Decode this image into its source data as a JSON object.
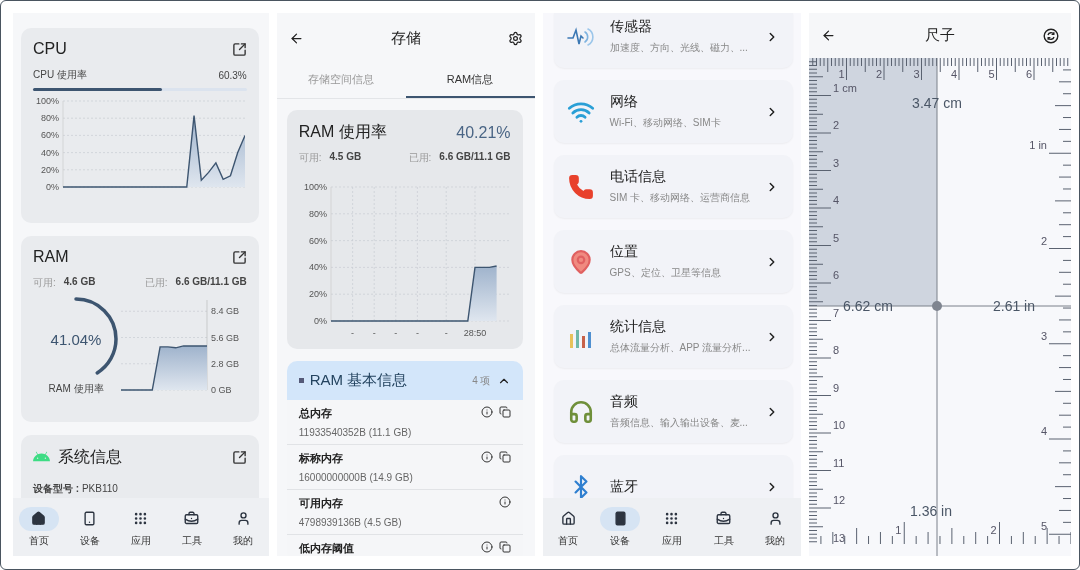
{
  "home_screen": {
    "cpu_card": {
      "title": "CPU",
      "usage_label": "CPU 使用率",
      "usage_value": "60.3%",
      "level": 0.603,
      "chart_data": {
        "type": "area",
        "grid": true,
        "ylim": [
          0,
          100
        ],
        "yticks": [
          {
            "value": 0,
            "label": "0%"
          },
          {
            "value": 20,
            "label": "20%"
          },
          {
            "value": 40,
            "label": "40%"
          },
          {
            "value": 60,
            "label": "60%"
          },
          {
            "value": 80,
            "label": "80%"
          },
          {
            "value": 100,
            "label": "100%"
          }
        ],
        "series": [
          {
            "color": "#3d5570",
            "values": [
              0,
              0,
              0,
              0,
              0,
              0,
              0,
              0,
              0,
              0,
              0,
              0,
              0,
              0,
              0,
              0,
              0,
              0,
              83,
              8,
              17,
              28,
              9,
              13,
              40,
              60
            ]
          }
        ]
      }
    },
    "ram_card": {
      "title": "RAM",
      "available_label": "可用:",
      "available": "4.6 GB",
      "used_label": "已用:",
      "used": "6.6 GB/11.1 GB",
      "gauge": {
        "reading": "41.04%",
        "label": "RAM 使用率",
        "level": 0.4104
      },
      "chart_data": {
        "type": "area",
        "grid": true,
        "ylim": [
          0,
          9.6
        ],
        "yticks": [
          {
            "value": 0,
            "label": "0 GB"
          },
          {
            "value": 2.8,
            "label": "2.8 GB"
          },
          {
            "value": 5.6,
            "label": "5.6 GB"
          },
          {
            "value": 8.4,
            "label": "8.4 GB"
          }
        ],
        "series": [
          {
            "color": "#3d5570",
            "values": [
              0,
              0,
              0,
              0,
              0,
              4.6,
              4.6,
              4.5,
              4.7,
              4.7,
              4.7,
              4.7
            ]
          }
        ]
      }
    },
    "system_card": {
      "title": "系统信息",
      "model": "**设备型号 :** PKB110"
    },
    "nav": [
      {
        "label": "首页",
        "selected": true
      },
      {
        "label": "设备",
        "selected": false
      },
      {
        "label": "应用",
        "selected": false
      },
      {
        "label": "工具",
        "selected": false
      },
      {
        "label": "我的",
        "selected": false
      }
    ]
  },
  "storage_screen": {
    "title": "存储",
    "tabs": [
      {
        "label": "存储空间信息",
        "selected": false
      },
      {
        "label": "RAM信息",
        "selected": true
      }
    ],
    "usage_card": {
      "title": "RAM 使用率",
      "value": "40.21%",
      "available_label": "可用:",
      "available": "4.5 GB",
      "used_label": "已用:",
      "used": "6.6 GB/11.1 GB",
      "chart_data": {
        "type": "area",
        "grid": true,
        "ylim": [
          0,
          100
        ],
        "yticks": [
          {
            "value": 0,
            "label": "0%"
          },
          {
            "value": 20,
            "label": "20%"
          },
          {
            "value": 40,
            "label": "40%"
          },
          {
            "value": 60,
            "label": "60%"
          },
          {
            "value": 80,
            "label": "80%"
          },
          {
            "value": 100,
            "label": "100%"
          }
        ],
        "categories": [
          null,
          null,
          null,
          "-",
          null,
          null,
          "-",
          null,
          null,
          "-",
          null,
          null,
          "-",
          null,
          null,
          null,
          "-",
          null,
          null,
          null,
          "28:50",
          null,
          null,
          null,
          null,
          null
        ],
        "series": [
          {
            "color": "#3d5570",
            "values": [
              0,
              0,
              0,
              0,
              0,
              0,
              0,
              0,
              0,
              0,
              0,
              0,
              0,
              0,
              0,
              0,
              0,
              0,
              0,
              0,
              40,
              40,
              40,
              41,
              null,
              null
            ]
          }
        ]
      }
    },
    "info_section": {
      "title": "RAM 基本信息",
      "count": "4 项",
      "expanded": true,
      "rows": [
        {
          "name": "总内存",
          "value": "11933540352B (11.1 GB)",
          "copyable": true
        },
        {
          "name": "标称内存",
          "value": "16000000000B (14.9 GB)",
          "copyable": true
        },
        {
          "name": "可用内存",
          "value": "4798939136B (4.5 GB)",
          "copyable": false
        },
        {
          "name": "低内存阈值",
          "copyable": true
        }
      ]
    }
  },
  "device_screen": {
    "items": [
      {
        "title": "传感器",
        "subtitle": "加速度、方向、光线、磁力、..."
      },
      {
        "title": "网络",
        "subtitle": "Wi-Fi、移动网络、SIM卡"
      },
      {
        "title": "电话信息",
        "subtitle": "SIM 卡、移动网络、运营商信息"
      },
      {
        "title": "位置",
        "subtitle": "GPS、定位、卫星等信息"
      },
      {
        "title": "统计信息",
        "subtitle": "总体流量分析、APP 流量分析..."
      },
      {
        "title": "音频",
        "subtitle": "音频信息、输入输出设备、麦..."
      },
      {
        "title": "蓝牙"
      }
    ],
    "nav": [
      {
        "label": "首页",
        "selected": false
      },
      {
        "label": "设备",
        "selected": true
      },
      {
        "label": "应用",
        "selected": false
      },
      {
        "label": "工具",
        "selected": false
      },
      {
        "label": "我的",
        "selected": false
      }
    ]
  },
  "ruler_screen": {
    "title": "尺子",
    "top_cm_labels": [
      "1",
      "2",
      "3",
      "4",
      "5",
      "6"
    ],
    "left_cm_labels": [
      "1 cm",
      "2",
      "3",
      "4",
      "5",
      "6",
      "7",
      "8",
      "9",
      "10",
      "11",
      "12",
      "13"
    ],
    "right_in_labels": [
      "1 in",
      "2",
      "3",
      "4",
      "5"
    ],
    "bottom_in_labels": [
      "1",
      "2"
    ],
    "measure_top": "3.47 cm",
    "measure_left": "6.62 cm",
    "measure_right": "2.61 in",
    "measure_bottom": "1.36 in"
  }
}
